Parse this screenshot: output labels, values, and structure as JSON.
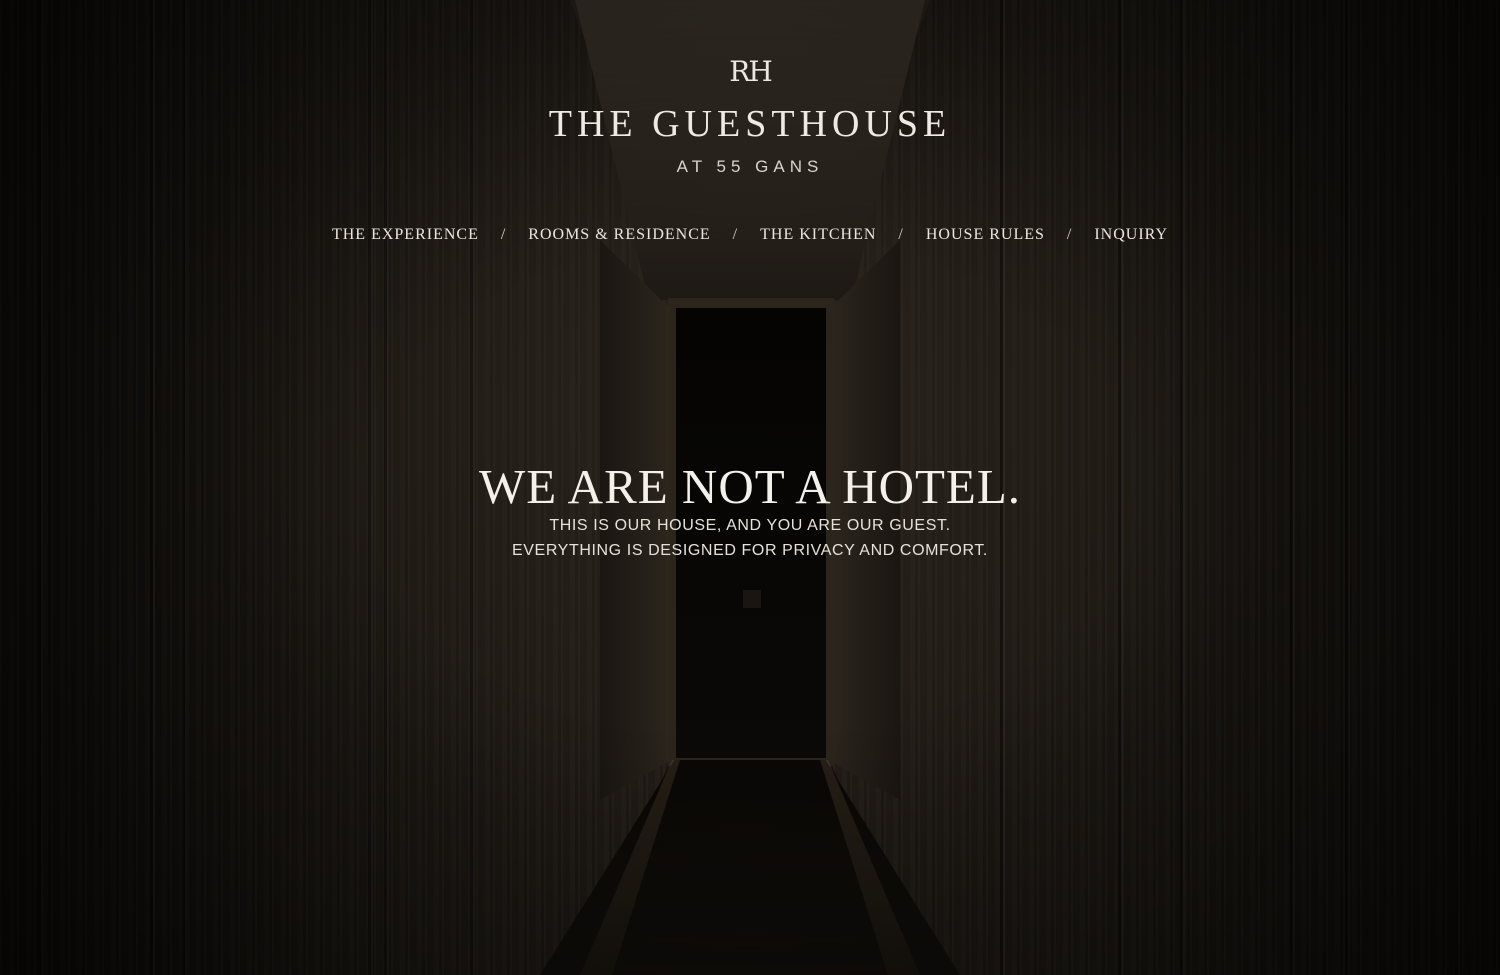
{
  "brand": {
    "monogram": "RH",
    "title": "THE GUESTHOUSE",
    "subtitle": "AT 55 GANS"
  },
  "nav": {
    "separator": "/",
    "items": [
      {
        "label": "THE EXPERIENCE"
      },
      {
        "label": "ROOMS & RESIDENCE"
      },
      {
        "label": "THE KITCHEN"
      },
      {
        "label": "HOUSE RULES"
      },
      {
        "label": "INQUIRY"
      }
    ]
  },
  "hero": {
    "headline": "WE ARE NOT A HOTEL.",
    "line1": "THIS IS OUR HOUSE, AND YOU ARE OUR GUEST.",
    "line2": "EVERYTHING IS DESIGNED FOR PRIVACY AND COMFORT."
  }
}
